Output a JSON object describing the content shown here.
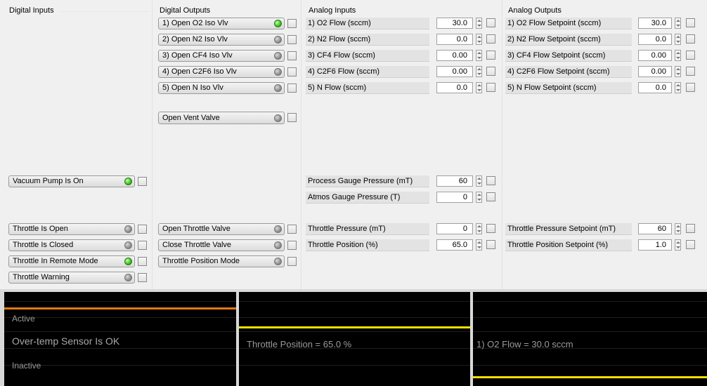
{
  "columns": {
    "digital_inputs": "Digital Inputs",
    "digital_outputs": "Digital Outputs",
    "analog_inputs": "Analog Inputs",
    "analog_outputs": "Analog Outputs"
  },
  "digital_inputs": [
    {
      "label": "Vacuum Pump Is On",
      "state": "on"
    },
    {
      "label": "Throttle Is Open",
      "state": "off"
    },
    {
      "label": "Throttle Is Closed",
      "state": "off"
    },
    {
      "label": "Throttle In Remote Mode",
      "state": "on"
    },
    {
      "label": "Throttle Warning",
      "state": "off"
    }
  ],
  "digital_outputs": [
    {
      "label": "1) Open O2 Iso Vlv",
      "state": "on"
    },
    {
      "label": "2) Open N2 Iso Vlv",
      "state": "off"
    },
    {
      "label": "3) Open CF4 Iso Vlv",
      "state": "off"
    },
    {
      "label": "4) Open C2F6 Iso Vlv",
      "state": "off"
    },
    {
      "label": "5) Open N Iso Vlv",
      "state": "off"
    },
    {
      "label": "Open Vent Valve",
      "state": "off"
    },
    {
      "label": "Open Throttle Valve",
      "state": "off"
    },
    {
      "label": "Close Throttle Valve",
      "state": "off"
    },
    {
      "label": "Throttle Position Mode",
      "state": "off"
    }
  ],
  "analog_inputs": [
    {
      "label": "1) O2 Flow (sccm)",
      "value": "30.0"
    },
    {
      "label": "2) N2 Flow (sccm)",
      "value": "0.0"
    },
    {
      "label": "3) CF4 Flow (sccm)",
      "value": "0.00"
    },
    {
      "label": "4) C2F6 Flow (sccm)",
      "value": "0.00"
    },
    {
      "label": "5) N Flow (sccm)",
      "value": "0.0"
    },
    {
      "label": "Process Gauge Pressure (mT)",
      "value": "60"
    },
    {
      "label": "Atmos Gauge Pressure (T)",
      "value": "0"
    },
    {
      "label": "Throttle Pressure (mT)",
      "value": "0"
    },
    {
      "label": "Throttle Position (%)",
      "value": "65.0"
    }
  ],
  "analog_outputs": [
    {
      "label": "1) O2 Flow Setpoint (sccm)",
      "value": "30.0"
    },
    {
      "label": "2) N2 Flow Setpoint (sccm)",
      "value": "0.0"
    },
    {
      "label": "3) CF4 Flow Setpoint (sccm)",
      "value": "0.00"
    },
    {
      "label": "4) C2F6 Flow Setpoint (sccm)",
      "value": "0.00"
    },
    {
      "label": "5) N Flow Setpoint (sccm)",
      "value": "0.0"
    },
    {
      "label": "Throttle Pressure Setpoint (mT)",
      "value": "60"
    },
    {
      "label": "Throttle Position Setpoint (%)",
      "value": "1.0"
    }
  ],
  "charts": {
    "left": {
      "active_label": "Active",
      "main_label": "Over-temp Sensor Is OK",
      "inactive_label": "Inactive",
      "trace_color": "#e07a10"
    },
    "middle": {
      "label": "Throttle Position = 65.0 %",
      "trace_color": "#f0e000"
    },
    "right": {
      "label": "1) O2 Flow = 30.0 sccm",
      "trace_color": "#f0e000"
    }
  },
  "colors": {
    "led_on": "#36c01c",
    "led_off": "#8f8f8f",
    "panel_background": "#f0f0f0",
    "chart_background": "#000000"
  }
}
